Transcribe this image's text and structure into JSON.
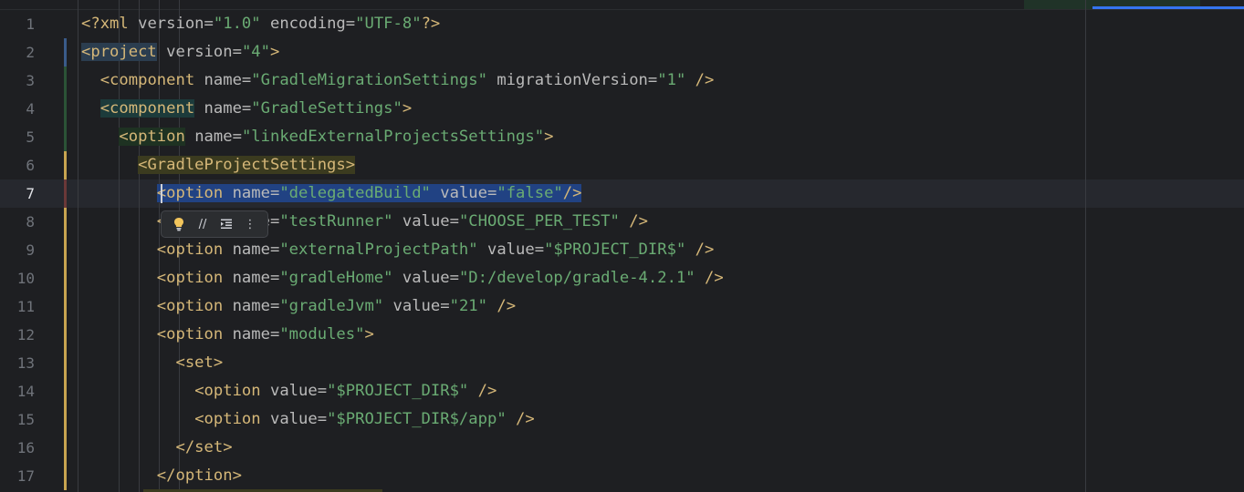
{
  "colors": {
    "background": "#1e1f22",
    "tag": "#d5b778",
    "attribute": "#bababa",
    "value": "#6aab73",
    "selection": "#214283",
    "line_number": "#6f737a",
    "change_marker_added": "#c7a450",
    "change_marker_modified": "#6a3838"
  },
  "editor": {
    "current_line": 7,
    "lines": [
      {
        "n": "1",
        "parts": [
          [
            "tag",
            "<?xml "
          ],
          [
            "attr",
            "version="
          ],
          [
            "val",
            "\"1.0\""
          ],
          [
            "attr",
            " encoding="
          ],
          [
            "val",
            "\"UTF-8\""
          ],
          [
            "tag",
            "?>"
          ]
        ]
      },
      {
        "n": "2",
        "parts": [
          [
            "tag hl-project",
            "<project"
          ],
          [
            "attr",
            " version="
          ],
          [
            "val",
            "\"4\""
          ],
          [
            "tag",
            ">"
          ]
        ]
      },
      {
        "n": "3",
        "parts": [
          [
            "",
            "  "
          ],
          [
            "tag",
            "<component"
          ],
          [
            "attr",
            " name="
          ],
          [
            "val",
            "\"GradleMigrationSettings\""
          ],
          [
            "attr",
            " migrationVersion="
          ],
          [
            "val",
            "\"1\""
          ],
          [
            "tag",
            " />"
          ]
        ]
      },
      {
        "n": "4",
        "parts": [
          [
            "",
            "  "
          ],
          [
            "tag hl-component",
            "<component"
          ],
          [
            "attr",
            " name="
          ],
          [
            "val",
            "\"GradleSettings\""
          ],
          [
            "tag",
            ">"
          ]
        ]
      },
      {
        "n": "5",
        "parts": [
          [
            "",
            "    "
          ],
          [
            "tag hl-option",
            "<option"
          ],
          [
            "attr",
            " name="
          ],
          [
            "val",
            "\"linkedExternalProjectsSettings\""
          ],
          [
            "tag",
            ">"
          ]
        ]
      },
      {
        "n": "6",
        "parts": [
          [
            "",
            "      "
          ],
          [
            "tag hl-gps",
            "<GradleProjectSettings>"
          ]
        ]
      },
      {
        "n": "7",
        "parts": [
          [
            "",
            "        "
          ],
          [
            "tag sel",
            "<option"
          ],
          [
            "attr sel",
            " name="
          ],
          [
            "val sel",
            "\"delegatedBuild\""
          ],
          [
            "attr sel",
            " value="
          ],
          [
            "val sel",
            "\"false\""
          ],
          [
            "tag sel",
            "/>"
          ]
        ]
      },
      {
        "n": "8",
        "parts": [
          [
            "",
            "        "
          ],
          [
            "tag",
            "<option"
          ],
          [
            "attr",
            " name="
          ],
          [
            "val",
            "\"testRunner\""
          ],
          [
            "attr",
            " value="
          ],
          [
            "val",
            "\"CHOOSE_PER_TEST\""
          ],
          [
            "tag",
            " />"
          ]
        ]
      },
      {
        "n": "9",
        "parts": [
          [
            "",
            "        "
          ],
          [
            "tag",
            "<option"
          ],
          [
            "attr",
            " name="
          ],
          [
            "val",
            "\"externalProjectPath\""
          ],
          [
            "attr",
            " value="
          ],
          [
            "val",
            "\"$PROJECT_DIR$\""
          ],
          [
            "tag",
            " />"
          ]
        ]
      },
      {
        "n": "10",
        "parts": [
          [
            "",
            "        "
          ],
          [
            "tag",
            "<option"
          ],
          [
            "attr",
            " name="
          ],
          [
            "val",
            "\"gradleHome\""
          ],
          [
            "attr",
            " value="
          ],
          [
            "val",
            "\"D:/develop/gradle-4.2.1\""
          ],
          [
            "tag",
            " />"
          ]
        ]
      },
      {
        "n": "11",
        "parts": [
          [
            "",
            "        "
          ],
          [
            "tag",
            "<option"
          ],
          [
            "attr",
            " name="
          ],
          [
            "val",
            "\"gradleJvm\""
          ],
          [
            "attr",
            " value="
          ],
          [
            "val",
            "\"21\""
          ],
          [
            "tag",
            " />"
          ]
        ]
      },
      {
        "n": "12",
        "parts": [
          [
            "",
            "        "
          ],
          [
            "tag",
            "<option"
          ],
          [
            "attr",
            " name="
          ],
          [
            "val",
            "\"modules\""
          ],
          [
            "tag",
            ">"
          ]
        ]
      },
      {
        "n": "13",
        "parts": [
          [
            "",
            "          "
          ],
          [
            "tag",
            "<set>"
          ]
        ]
      },
      {
        "n": "14",
        "parts": [
          [
            "",
            "            "
          ],
          [
            "tag",
            "<option"
          ],
          [
            "attr",
            " value="
          ],
          [
            "val",
            "\"$PROJECT_DIR$\""
          ],
          [
            "tag",
            " />"
          ]
        ]
      },
      {
        "n": "15",
        "parts": [
          [
            "",
            "            "
          ],
          [
            "tag",
            "<option"
          ],
          [
            "attr",
            " value="
          ],
          [
            "val",
            "\"$PROJECT_DIR$/app\""
          ],
          [
            "tag",
            " />"
          ]
        ]
      },
      {
        "n": "16",
        "parts": [
          [
            "",
            "          "
          ],
          [
            "tag",
            "</set>"
          ]
        ]
      },
      {
        "n": "17",
        "parts": [
          [
            "",
            "        "
          ],
          [
            "tag",
            "</option>"
          ]
        ]
      }
    ]
  },
  "intention_popup": {
    "icons": [
      "lightbulb-icon",
      "comment-icon",
      "reformat-icon",
      "more-vertical-icon"
    ],
    "glyphs": {
      "comment": "//",
      "more": "⋮"
    }
  }
}
